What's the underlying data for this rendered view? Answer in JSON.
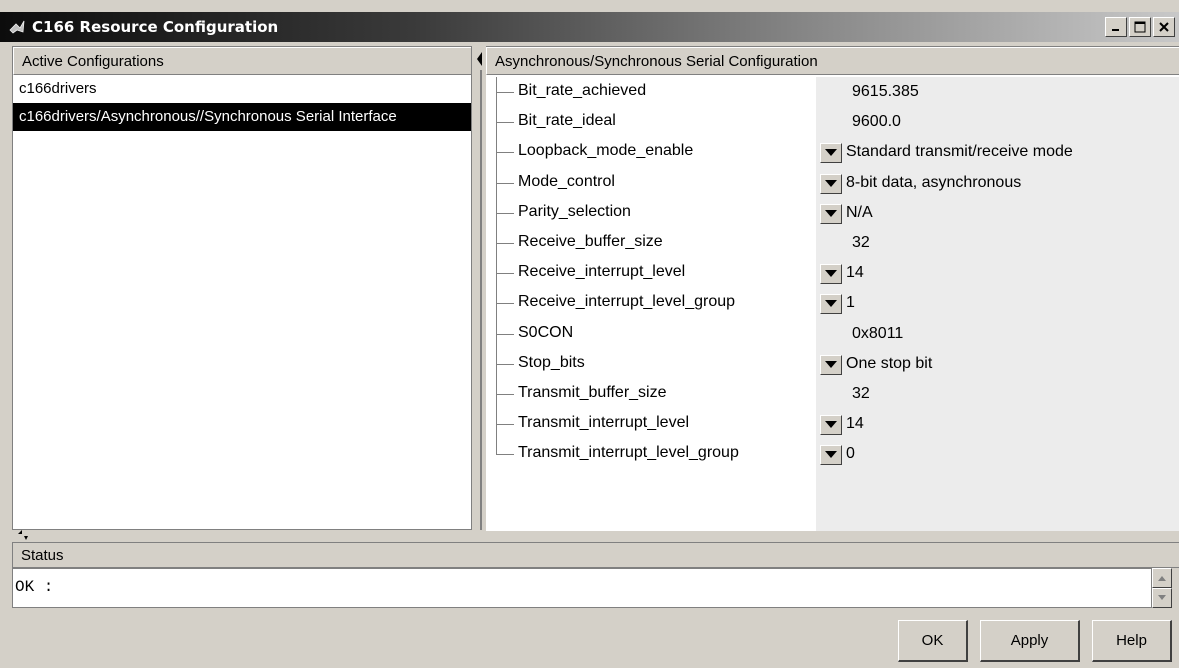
{
  "window": {
    "title": "C166 Resource Configuration"
  },
  "left": {
    "header": "Active Configurations",
    "items": [
      "c166drivers",
      "c166drivers/Asynchronous//Synchronous Serial Interface"
    ],
    "selected_index": 1
  },
  "right": {
    "header": "Asynchronous/Synchronous Serial Configuration",
    "properties": [
      {
        "name": "Bit_rate_achieved",
        "value": "9615.385",
        "dropdown": false
      },
      {
        "name": "Bit_rate_ideal",
        "value": "9600.0",
        "dropdown": false
      },
      {
        "name": "Loopback_mode_enable",
        "value": "Standard transmit/receive mode",
        "dropdown": true
      },
      {
        "name": "Mode_control",
        "value": "8-bit data, asynchronous",
        "dropdown": true
      },
      {
        "name": "Parity_selection",
        "value": "N/A",
        "dropdown": true
      },
      {
        "name": "Receive_buffer_size",
        "value": "32",
        "dropdown": false
      },
      {
        "name": "Receive_interrupt_level",
        "value": "14",
        "dropdown": true
      },
      {
        "name": "Receive_interrupt_level_group",
        "value": "1",
        "dropdown": true
      },
      {
        "name": "S0CON",
        "value": "0x8011",
        "dropdown": false
      },
      {
        "name": "Stop_bits",
        "value": "One stop bit",
        "dropdown": true
      },
      {
        "name": "Transmit_buffer_size",
        "value": "32",
        "dropdown": false
      },
      {
        "name": "Transmit_interrupt_level",
        "value": "14",
        "dropdown": true
      },
      {
        "name": "Transmit_interrupt_level_group",
        "value": "0",
        "dropdown": true
      }
    ]
  },
  "status": {
    "label": "Status",
    "text": "OK :"
  },
  "buttons": {
    "ok": "OK",
    "apply": "Apply",
    "help": "Help"
  },
  "colors": {
    "selection_bg": "#000000",
    "chrome": "#d4d0c8",
    "value_column_bg": "#ececec"
  },
  "icons": {
    "app": "matlab-logo-icon",
    "dropdown": "triangle-down-icon"
  }
}
